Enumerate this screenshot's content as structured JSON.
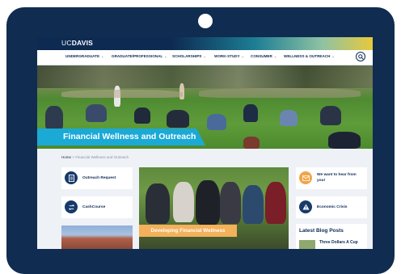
{
  "header": {
    "logo_prefix": "UC",
    "logo_name": "DAVIS"
  },
  "nav": {
    "items": [
      {
        "label": "UNDERGRADUATE"
      },
      {
        "label": "GRADUATE/PROFESSIONAL"
      },
      {
        "label": "SCHOLARSHIPS"
      },
      {
        "label": "WORK-STUDY"
      },
      {
        "label": "CONSUMER"
      },
      {
        "label": "WELLNESS & OUTREACH"
      }
    ],
    "chevron": "⌄",
    "search_icon": "search-icon"
  },
  "hero": {
    "title": "Financial Wellness and Outreach"
  },
  "breadcrumb": {
    "home": "Home",
    "separator": ">",
    "current": "Financial Wellness and Outreach"
  },
  "left_cards": [
    {
      "label": "Outreach Request",
      "icon": "document-icon"
    },
    {
      "label": "CashCourse",
      "icon": "arrows-icon"
    }
  ],
  "feature": {
    "caption": "Developing Financial Wellness"
  },
  "right_cards": [
    {
      "label_line1": "We want to hear from",
      "label_line2": "you!",
      "icon": "mail-icon"
    },
    {
      "label": "Economic Crisis",
      "icon": "warning-icon"
    }
  ],
  "blog": {
    "heading": "Latest Blog Posts",
    "first_post": "Three Dollars A Cup"
  },
  "colors": {
    "navy": "#0d2a52",
    "frame": "#102c50",
    "cyan": "#1ba9d6",
    "orange": "#f4b05a"
  }
}
